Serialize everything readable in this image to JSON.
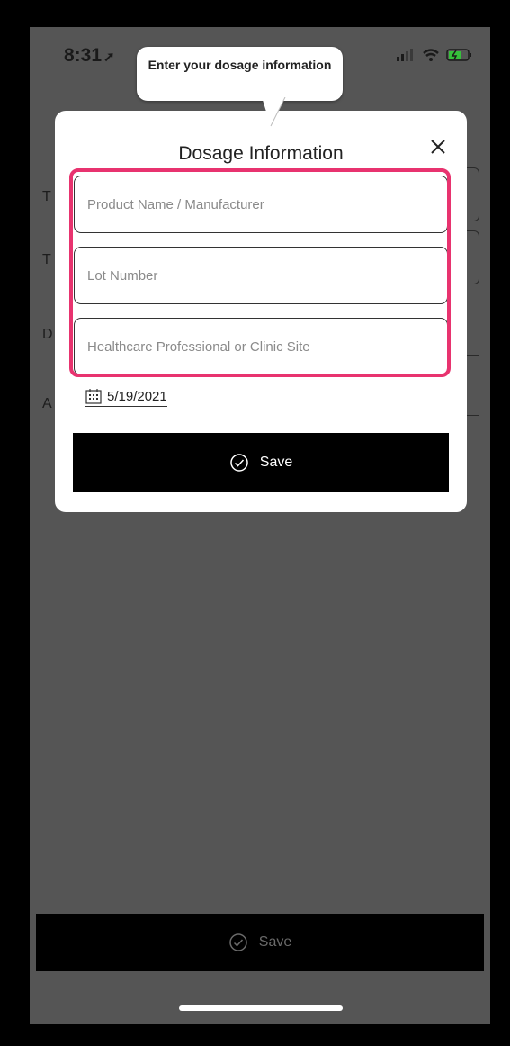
{
  "status_bar": {
    "time": "8:31",
    "location_glyph": "➚"
  },
  "background": {
    "frag_1": "T",
    "frag_2": "T",
    "frag_3": "D",
    "frag_4": "A",
    "save_label": "Save"
  },
  "tooltip": {
    "text": "Enter your dosage information"
  },
  "modal": {
    "title": "Dosage Information",
    "close_glyph": "✕",
    "fields": {
      "product": {
        "value": "",
        "placeholder": "Product Name / Manufacturer"
      },
      "lot": {
        "value": "",
        "placeholder": "Lot Number"
      },
      "site": {
        "value": "",
        "placeholder": "Healthcare Professional or Clinic Site"
      }
    },
    "date": "5/19/2021",
    "save_label": "Save"
  },
  "colors": {
    "highlight": "#e8336f",
    "overlay": "#555555",
    "button": "#000000"
  },
  "icons": [
    "location-arrow-icon",
    "signal-icon",
    "wifi-icon",
    "battery-icon",
    "close-icon",
    "calendar-icon",
    "check-circle-icon"
  ]
}
